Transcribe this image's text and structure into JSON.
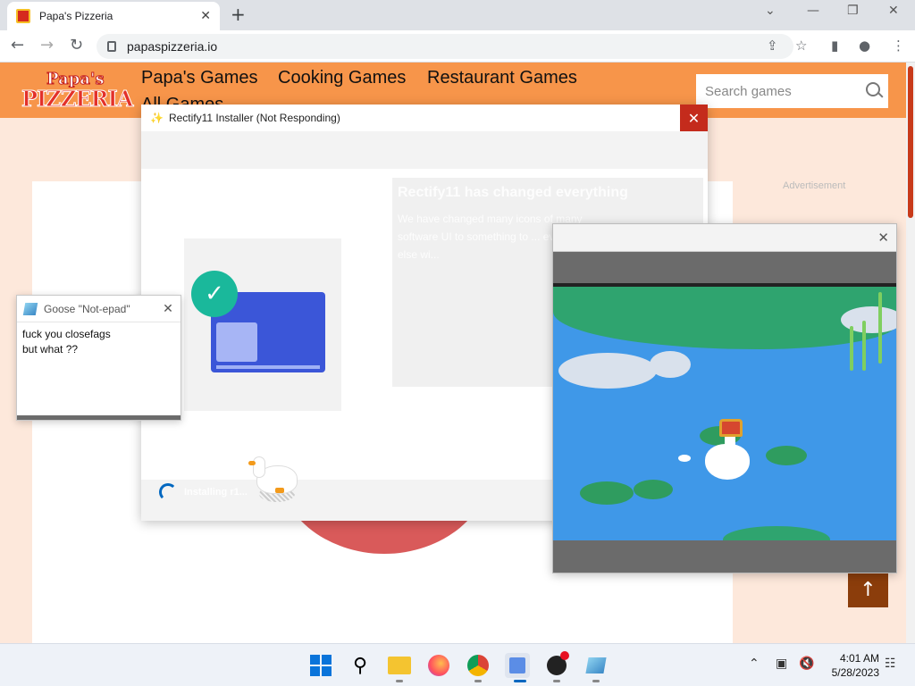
{
  "browser": {
    "tab_title": "Papa's Pizzeria",
    "url": "papaspizzeria.io"
  },
  "site": {
    "logo_line1": "Papa's",
    "logo_line2": "PIZZERIA",
    "nav": [
      "Papa's Games",
      "Cooking Games",
      "Restaurant Games",
      "All Games"
    ],
    "search_placeholder": "Search games",
    "ad_label": "Advertisement",
    "scroll_top_label": "↑"
  },
  "installer": {
    "title": "Rectify11 Installer (Not Responding)",
    "heading": "Rectify11 has changed everything",
    "body": "We have changed many icons of many software UI to something to ... everything else wi...",
    "status": "Installing r1..."
  },
  "notepad": {
    "title": "Goose \"Not-epad\"",
    "line1": "fuck you closefags",
    "line2": "but what ??"
  },
  "taskbar": {
    "time": "4:01 AM",
    "date": "5/28/2023"
  },
  "colors": {
    "site_header": "#f7954a",
    "site_bg": "#fde8db",
    "close_red": "#c42b1c",
    "accent_blue": "#0067c0"
  }
}
